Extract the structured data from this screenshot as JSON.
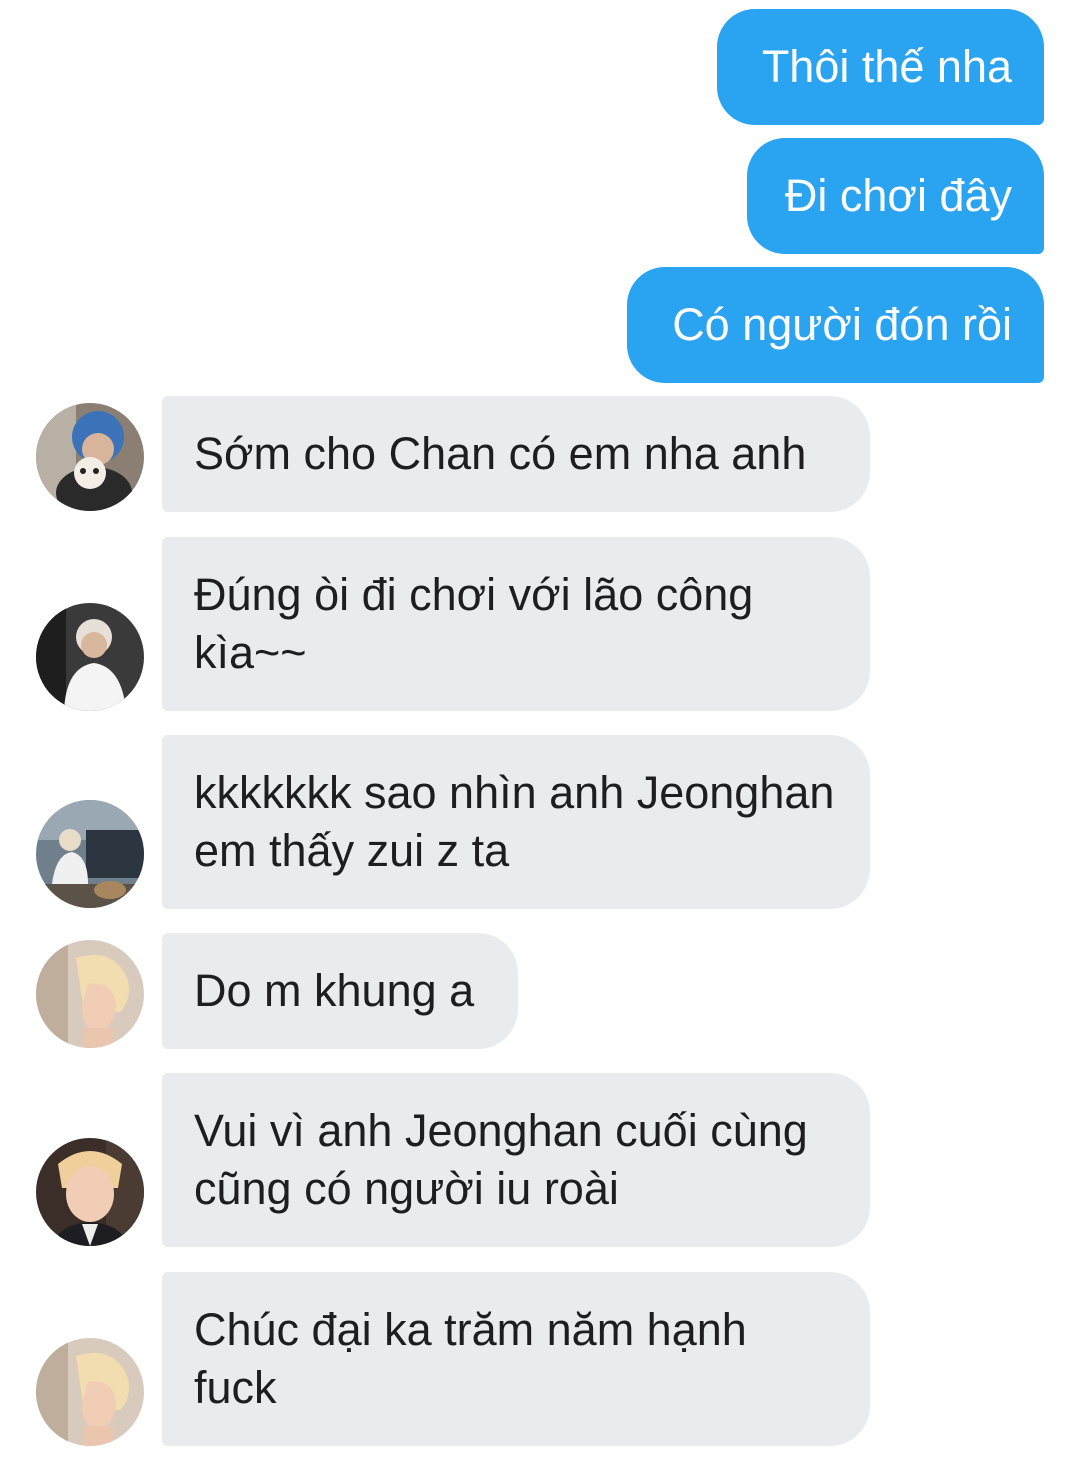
{
  "conversation": {
    "outgoing": [
      {
        "text": "Thôi thế nha"
      },
      {
        "text": "Đi chơi đây"
      },
      {
        "text": "Có người đón rồi"
      }
    ],
    "incoming": [
      {
        "text": "Sớm cho Chan có em nha anh",
        "avatar": "avatar-blue-hair-with-dog"
      },
      {
        "text": "Đúng òi đi chơi với lão công kìa~~",
        "avatar": "avatar-white-shirt"
      },
      {
        "text": "kkkkkkk sao nhìn anh Jeonghan em thấy zui z ta",
        "avatar": "avatar-crouching-by-car"
      },
      {
        "text": "Do m khung a",
        "avatar": "avatar-blonde-profile"
      },
      {
        "text": "Vui vì anh Jeonghan cuối cùng cũng có người iu roài",
        "avatar": "avatar-blonde-suit"
      },
      {
        "text": "Chúc đại ka trăm năm hạnh fuck",
        "avatar": "avatar-blonde-profile"
      }
    ]
  },
  "colors": {
    "outgoing_bubble": "#2aa3f0",
    "incoming_bubble": "#e9ecef",
    "incoming_text": "#1c1e21",
    "outgoing_text": "#ffffff"
  }
}
